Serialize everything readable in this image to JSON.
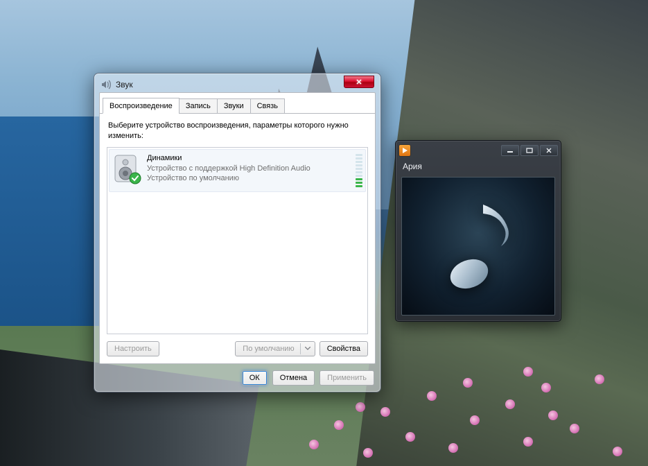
{
  "sound_dialog": {
    "title": "Звук",
    "tabs": [
      {
        "label": "Воспроизведение",
        "active": true
      },
      {
        "label": "Запись",
        "active": false
      },
      {
        "label": "Звуки",
        "active": false
      },
      {
        "label": "Связь",
        "active": false
      }
    ],
    "instruction": "Выберите устройство воспроизведения, параметры которого нужно изменить:",
    "device": {
      "name": "Динамики",
      "desc1": "Устройство с поддержкой High Definition Audio",
      "desc2": "Устройство по умолчанию",
      "level_total": 10,
      "level_active": 3
    },
    "buttons": {
      "configure": "Настроить",
      "default": "По умолчанию",
      "properties": "Свойства",
      "ok": "ОК",
      "cancel": "Отмена",
      "apply": "Применить"
    }
  },
  "media_player": {
    "now_playing": "Ария"
  }
}
